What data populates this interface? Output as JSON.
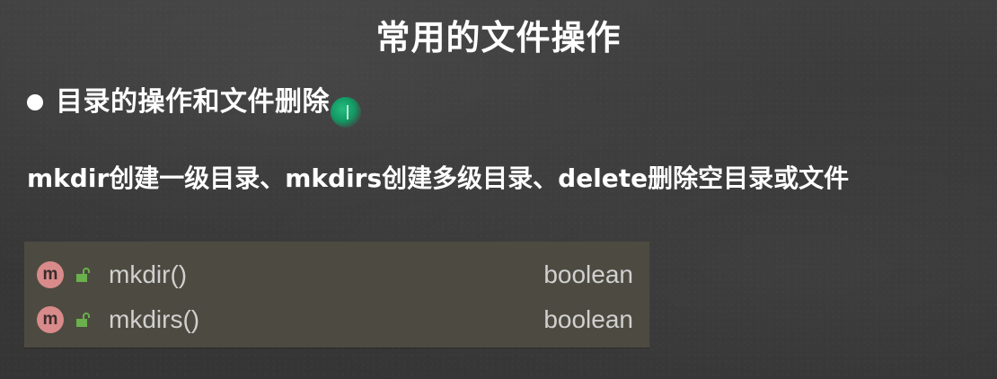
{
  "slide": {
    "title": "常用的文件操作",
    "bullet": "目录的操作和文件删除",
    "description": "mkdir创建一级目录、mkdirs创建多级目录、delete删除空目录或文件"
  },
  "completion_popup": {
    "items": [
      {
        "badge": "m",
        "icon": "unlocked-lock-icon",
        "name": "mkdir()",
        "type": "boolean"
      },
      {
        "badge": "m",
        "icon": "unlocked-lock-icon",
        "name": "mkdirs()",
        "type": "boolean"
      }
    ]
  },
  "colors": {
    "board_background": "#3a3a3a",
    "text": "#ffffff",
    "popup_background": "#4d4b41",
    "method_badge": "#d98a8a",
    "lock_icon": "#6ab04c",
    "popup_text": "#d0d0d0"
  }
}
